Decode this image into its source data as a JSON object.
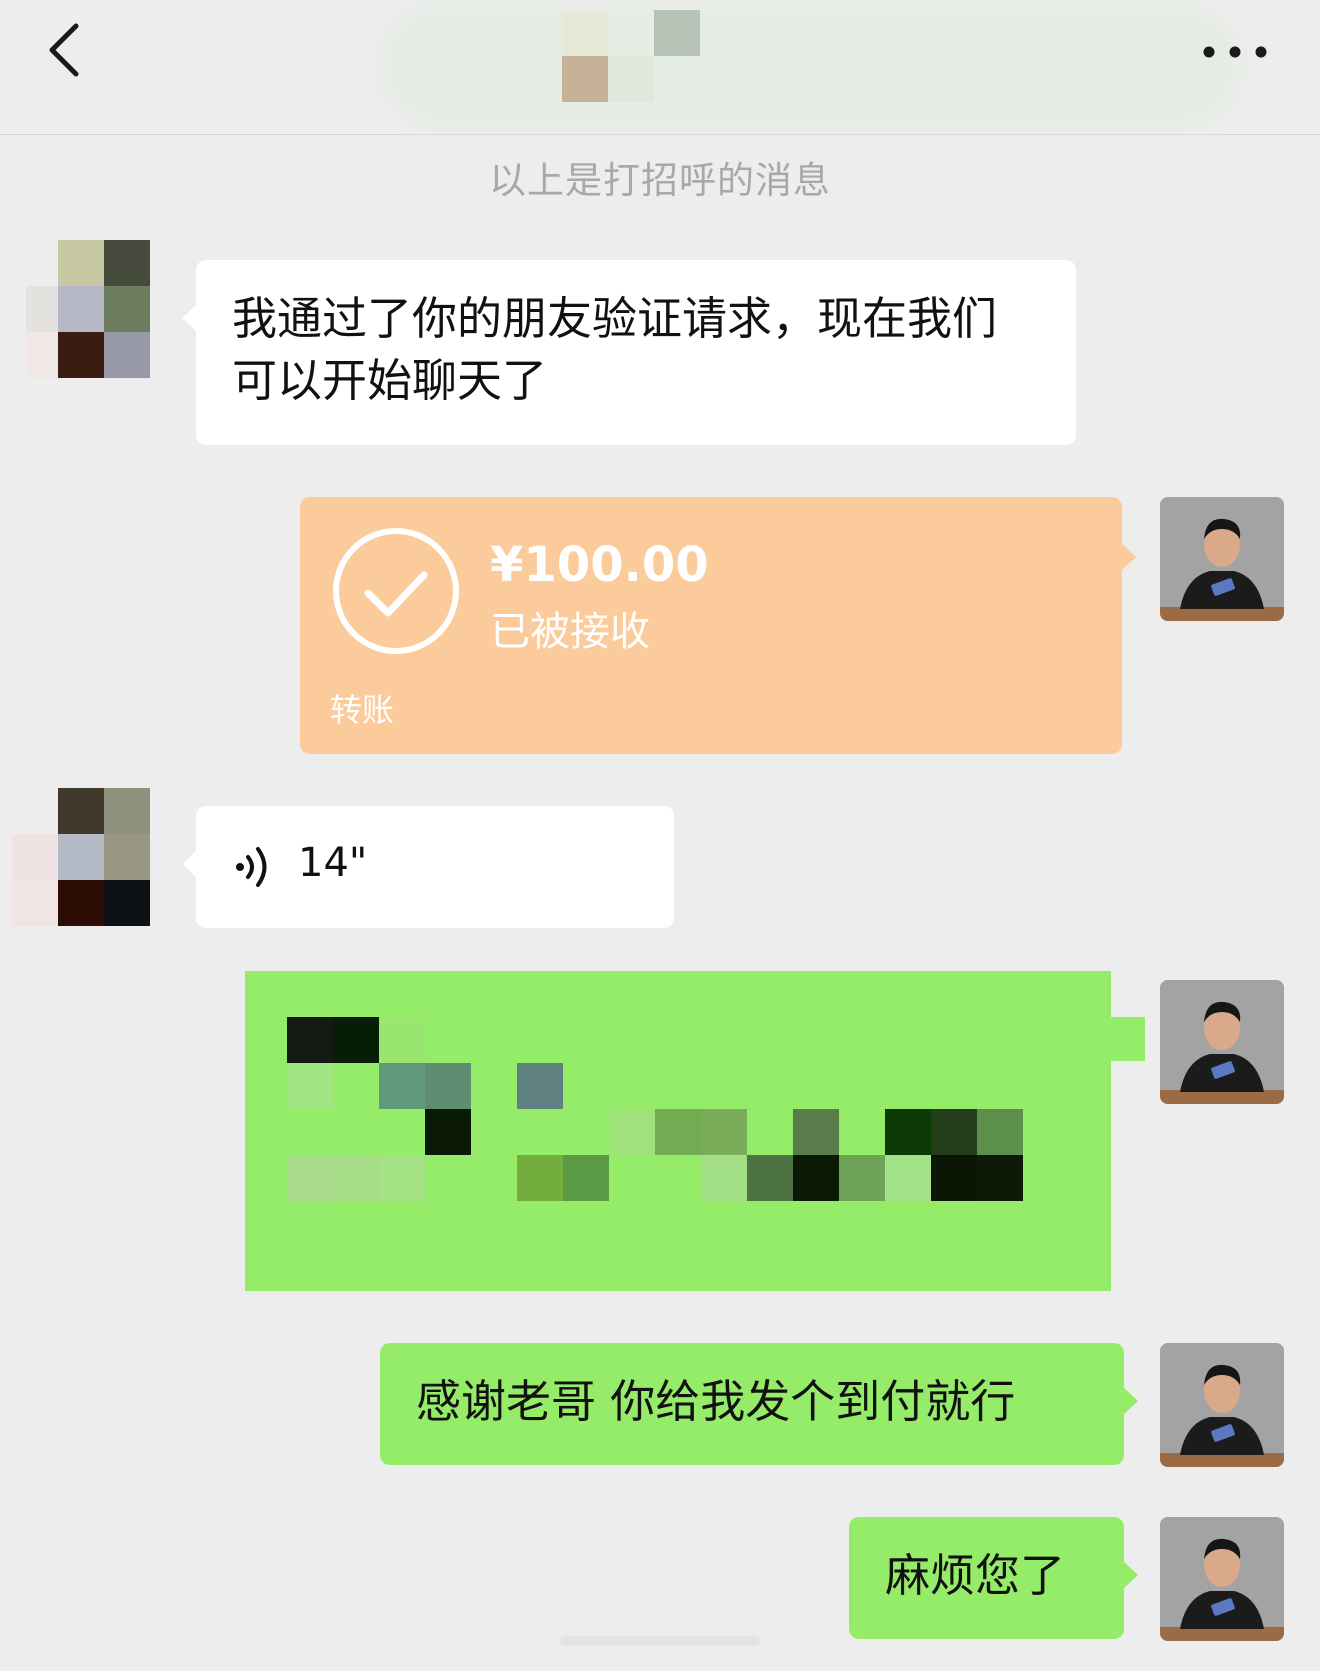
{
  "header": {
    "back_icon": "chevron-left-icon",
    "more_icon": "more-dots-icon"
  },
  "system_message": "以上是打招呼的消息",
  "messages": [
    {
      "type": "text",
      "side": "left",
      "text": "我通过了你的朋友验证请求，现在我们可以开始聊天了"
    },
    {
      "type": "transfer",
      "side": "right",
      "amount": "¥100.00",
      "status": "已被接收",
      "label": "转账"
    },
    {
      "type": "voice",
      "side": "left",
      "duration": "14\""
    },
    {
      "type": "text",
      "side": "right",
      "text": ""
    },
    {
      "type": "text",
      "side": "right",
      "text": "感谢老哥 你给我发个到付就行"
    },
    {
      "type": "text",
      "side": "right",
      "text": "麻烦您了"
    }
  ],
  "colors": {
    "background": "#ededed",
    "bubble_self": "#95ec69",
    "bubble_other": "#ffffff",
    "transfer": "#fbcb9b"
  }
}
